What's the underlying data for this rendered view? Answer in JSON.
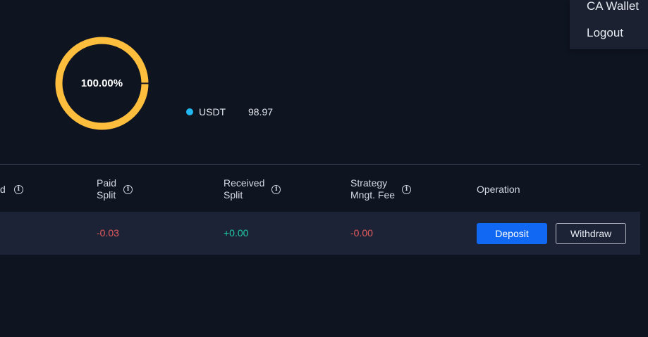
{
  "allocation": {
    "percent_label": "100.00%",
    "ring_color": "#FDBE3D",
    "fraction": 1.0,
    "legend": [
      {
        "name": "USDT",
        "value": "98.97",
        "color": "#23B7F0"
      }
    ]
  },
  "user_menu": {
    "items": [
      {
        "label": "CA Wallet"
      },
      {
        "label": "Logout"
      }
    ]
  },
  "table": {
    "headers": {
      "partial_first": "d",
      "paid_split": [
        "Paid",
        "Split"
      ],
      "received_split": [
        "Received",
        "Split"
      ],
      "strategy_fee": [
        "Strategy",
        "Mngt. Fee"
      ],
      "operation": "Operation"
    },
    "row": {
      "paid_split": "-0.03",
      "received_split": "+0.00",
      "strategy_fee": "-0.00",
      "deposit_label": "Deposit",
      "withdraw_label": "Withdraw"
    }
  },
  "colors": {
    "background": "#0F1421",
    "row_background": "#1D2337",
    "negative": "#E45B5B",
    "positive": "#1FC9A6",
    "primary_button": "#1068F3"
  }
}
